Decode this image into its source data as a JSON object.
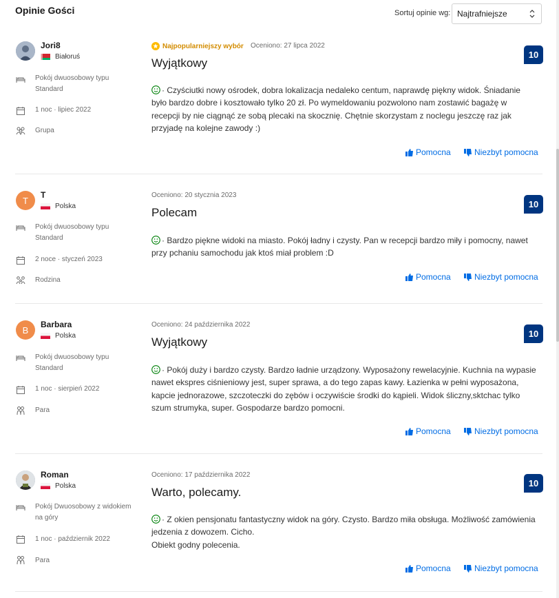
{
  "header": {
    "title": "Opinie Gości",
    "sort_label": "Sortuj opinie wg:",
    "sort_value": "Najtrafniejsze"
  },
  "colors": {
    "score_bg": "#003580",
    "link": "#006ce4",
    "popular": "#d38c00",
    "smile": "#008009"
  },
  "reviews": [
    {
      "name": "Jori8",
      "country": "Białoruś",
      "flag": "flag-belarus",
      "avatar": "photo",
      "room": "Pokój dwuosobowy typu Standard",
      "stay": "1 noc · lipiec 2022",
      "group": "Grupa",
      "group_icon": "group-icon",
      "popular_label": "Najpopularniejszy wybór",
      "rated": "Oceniono: 27 lipca 2022",
      "title": "Wyjątkowy",
      "score": "10",
      "text": "· Czyściutki nowy ośrodek, dobra lokalizacja nedaleko centum, naprawdę piękny widok. Śniadanie było bardzo dobre i kosztowało tylko 20 zł. Po wymeldowaniu pozwolono nam zostawić bagażę w recepcji by nie ciągnąć ze sobą plecaki na skocznię. Chętnie skorzystam z noclegu jeszczę raz jak przyjadę na kolejne zawody :)",
      "helpful": "Pomocna",
      "not_helpful": "Niezbyt pomocna"
    },
    {
      "name": "T",
      "country": "Polska",
      "flag": "flag-poland",
      "avatar": "T",
      "room": "Pokój dwuosobowy typu Standard",
      "stay": "2 noce · styczeń 2023",
      "group": "Rodzina",
      "group_icon": "family-icon",
      "rated": "Oceniono: 20 stycznia 2023",
      "title": "Polecam",
      "score": "10",
      "text": "· Bardzo piękne widoki na miasto. Pokój ładny i czysty. Pan w recepcji bardzo miły i pomocny, nawet przy pchaniu samochodu jak ktoś miał problem :D",
      "helpful": "Pomocna",
      "not_helpful": "Niezbyt pomocna"
    },
    {
      "name": "Barbara",
      "country": "Polska",
      "flag": "flag-poland",
      "avatar": "B",
      "room": "Pokój dwuosobowy typu Standard",
      "stay": "1 noc · sierpień 2022",
      "group": "Para",
      "group_icon": "couple-icon",
      "rated": "Oceniono: 24 października 2022",
      "title": "Wyjątkowy",
      "score": "10",
      "text": "· Pokój duży i bardzo czysty. Bardzo ładnie urządzony. Wyposażony rewelacyjnie. Kuchnia na wypasie nawet ekspres ciśnieniowy jest, super sprawa, a do tego zapas kawy. Łazienka w pełni wyposażona, kapcie jednorazowe, szczoteczki do zębów i oczywiście środki do kąpieli. Widok śliczny,sktchac tylko szum strumyka, super. Gospodarze bardzo pomocni.",
      "helpful": "Pomocna",
      "not_helpful": "Niezbyt pomocna"
    },
    {
      "name": "Roman",
      "country": "Polska",
      "flag": "flag-poland",
      "avatar": "photo",
      "room": "Pokój Dwuosobowy z widokiem na góry",
      "stay": "1 noc · październik 2022",
      "group": "Para",
      "group_icon": "couple-icon",
      "rated": "Oceniono: 17 października 2022",
      "title": "Warto, polecamy.",
      "score": "10",
      "text": "· Z okien pensjonatu fantastyczny widok na góry. Czysto. Bardzo miła obsługa. Możliwość zamówienia jedzenia z dowozem. Cicho.",
      "text2": "Obiekt godny polecenia.",
      "helpful": "Pomocna",
      "not_helpful": "Niezbyt pomocna"
    }
  ]
}
